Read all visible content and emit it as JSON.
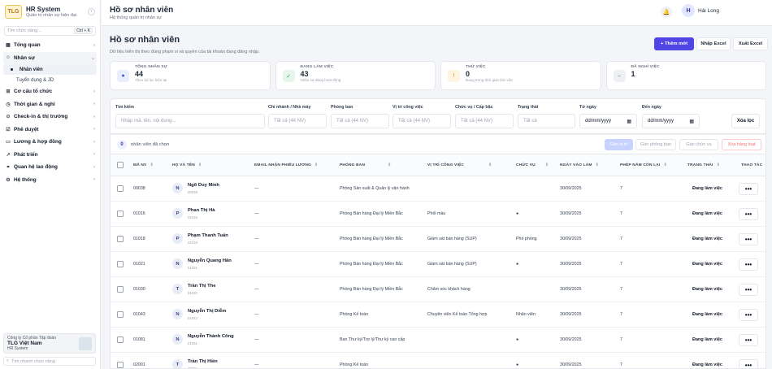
{
  "sidebar": {
    "logo": "TLG",
    "app_title": "HR System",
    "app_subtitle": "Quản trị nhân sự hiện đại",
    "search_placeholder": "Tìm chức năng...",
    "search_shortcut": "Ctrl + K",
    "items": [
      {
        "label": "Tổng quan",
        "icon": "grid-icon"
      },
      {
        "label": "Nhân sự",
        "icon": "user-icon",
        "open": true
      },
      {
        "label": "Cơ cấu tổ chức",
        "icon": "org-icon"
      },
      {
        "label": "Thời gian & nghỉ",
        "icon": "clock-icon"
      },
      {
        "label": "Check-in & thị trường",
        "icon": "location-icon"
      },
      {
        "label": "Phê duyệt",
        "icon": "check-icon"
      },
      {
        "label": "Lương & hợp đồng",
        "icon": "money-icon"
      },
      {
        "label": "Phát triển",
        "icon": "chart-icon"
      },
      {
        "label": "Quan hệ lao động",
        "icon": "handshake-icon"
      },
      {
        "label": "Hệ thống",
        "icon": "settings-icon"
      }
    ],
    "sub_items": [
      "Nhân viên",
      "Tuyển dụng & JD"
    ],
    "company": {
      "line1": "Công ty Cổ phần Tập đoàn",
      "name": "TLG Việt Nam",
      "line3": "HR System"
    },
    "footer_search_placeholder": "Tìm nhanh chức năng"
  },
  "header": {
    "title": "Hồ sơ nhân viên",
    "subtitle": "Hệ thống quản trị nhân sự",
    "user_initial": "H",
    "user_name": "Hải Long"
  },
  "page": {
    "title": "Hồ sơ nhân viên",
    "description": "Dữ liệu hiển thị theo đúng phạm vi và quyền của tài khoản đang đăng nhập.",
    "add_button": "+ Thêm mới",
    "import_button": "Nhập Excel",
    "export_button": "Xuất Excel"
  },
  "stats": [
    {
      "label": "TỔNG NHÂN SỰ",
      "value": "44",
      "desc": "Theo bộ lọc hiện tại",
      "icon": "●",
      "bg": "#e8eefc",
      "fg": "#3b5bdb"
    },
    {
      "label": "ĐANG LÀM VIỆC",
      "value": "43",
      "desc": "Nhân sự đang hoạt động",
      "icon": "✓",
      "bg": "#e6f6ec",
      "fg": "#2f9e44"
    },
    {
      "label": "THỬ VIỆC",
      "value": "0",
      "desc": "Đang trong thời gian thử việc",
      "icon": "!",
      "bg": "#fff4e0",
      "fg": "#e8890c"
    },
    {
      "label": "ĐÃ NGHỈ VIỆC",
      "value": "1",
      "desc": "",
      "icon": "–",
      "bg": "#eef0f3",
      "fg": "#6b7280"
    }
  ],
  "filters": {
    "search_label": "Tìm kiếm",
    "search_placeholder": "Nhập mã, tên, nội dung...",
    "branch_label": "Chi nhánh / Nhà máy",
    "branch_value": "Tất cả (44 NV)",
    "dept_label": "Phòng ban",
    "dept_value": "Tất cả (44 NV)",
    "position_label": "Vị trí công việc",
    "position_value": "Tất cả (44 NV)",
    "title_label": "Chức vụ / Cấp bậc",
    "title_value": "Tất cả (44 NV)",
    "status_label": "Trạng thái",
    "status_value": "Tất cả",
    "from_label": "Từ ngày",
    "from_value": "dd/mm/yyyy",
    "to_label": "Đến ngày",
    "to_value": "dd/mm/yyyy",
    "clear_button": "Xóa lọc"
  },
  "selection": {
    "count": "0",
    "text": "nhân viên đã chọn",
    "assign_position": "Gán vị trí",
    "assign_dept": "Gán phòng ban",
    "assign_title": "Gán chức vụ",
    "delete_bulk": "Xóa hàng loạt"
  },
  "table": {
    "columns": [
      "MÃ NV",
      "HỌ VÀ TÊN",
      "EMAIL NHẬN PHIẾU LƯƠNG",
      "PHÒNG BAN",
      "VỊ TRÍ CÔNG VIỆC",
      "CHỨC VỤ",
      "NGÀY VÀO LÀM",
      "PHÉP NĂM CÒN LẠI",
      "TRẠNG THÁI",
      "THAO TÁC"
    ],
    "rows": [
      {
        "code": "00038",
        "initial": "N",
        "name": "Ngô Duy Minh",
        "sub": "00038",
        "email": "—",
        "dept": "Phòng Sản xuất & Quản lý vận hành",
        "position": "",
        "title": "",
        "date": "30/09/2025",
        "leave": "7",
        "status": "Đang làm việc"
      },
      {
        "code": "01016",
        "initial": "P",
        "name": "Phan Thị Hà",
        "sub": "01016",
        "email": "—",
        "dept": "Phòng Bán hàng Đại lý Miền Bắc",
        "position": "Phối màu",
        "title": "●",
        "date": "30/09/2025",
        "leave": "7",
        "status": "Đang làm việc"
      },
      {
        "code": "01018",
        "initial": "P",
        "name": "Phạm Thanh Tuấn",
        "sub": "01018",
        "email": "—",
        "dept": "Phòng Bán hàng Đại lý Miền Bắc",
        "position": "Giám sát bán hàng (SUP)",
        "title": "Phó phòng",
        "date": "30/09/2025",
        "leave": "7",
        "status": "Đang làm việc"
      },
      {
        "code": "01021",
        "initial": "N",
        "name": "Nguyễn Quang Hân",
        "sub": "01021",
        "email": "—",
        "dept": "Phòng Bán hàng Đại lý Miền Bắc",
        "position": "Giám sát bán hàng (SUP)",
        "title": "●",
        "date": "30/09/2025",
        "leave": "7",
        "status": "Đang làm việc"
      },
      {
        "code": "01030",
        "initial": "T",
        "name": "Trần Thị The",
        "sub": "01030",
        "email": "—",
        "dept": "Phòng Bán hàng Đại lý Miền Bắc",
        "position": "Chăm sóc khách hàng",
        "title": "",
        "date": "30/09/2025",
        "leave": "7",
        "status": "Đang làm việc"
      },
      {
        "code": "01043",
        "initial": "N",
        "name": "Nguyễn Thị Diễm",
        "sub": "01043",
        "email": "—",
        "dept": "Phòng Kế toán",
        "position": "Chuyên viên Kế toán Tổng hợp",
        "title": "Nhân viên",
        "date": "30/09/2025",
        "leave": "7",
        "status": "Đang làm việc"
      },
      {
        "code": "01081",
        "initial": "N",
        "name": "Nguyễn Thành Công",
        "sub": "01081",
        "email": "—",
        "dept": "Ban Thư ký/Trợ lý/Thư ký cao cấp",
        "position": "",
        "title": "●",
        "date": "30/09/2025",
        "leave": "7",
        "status": "Đang làm việc"
      },
      {
        "code": "02001",
        "initial": "T",
        "name": "Trần Thị Hiền",
        "sub": "02001",
        "email": "—",
        "dept": "Phòng Kế toán",
        "position": "",
        "title": "●",
        "date": "30/09/2025",
        "leave": "7",
        "status": "Đang làm việc"
      }
    ],
    "action_label": "•••"
  }
}
